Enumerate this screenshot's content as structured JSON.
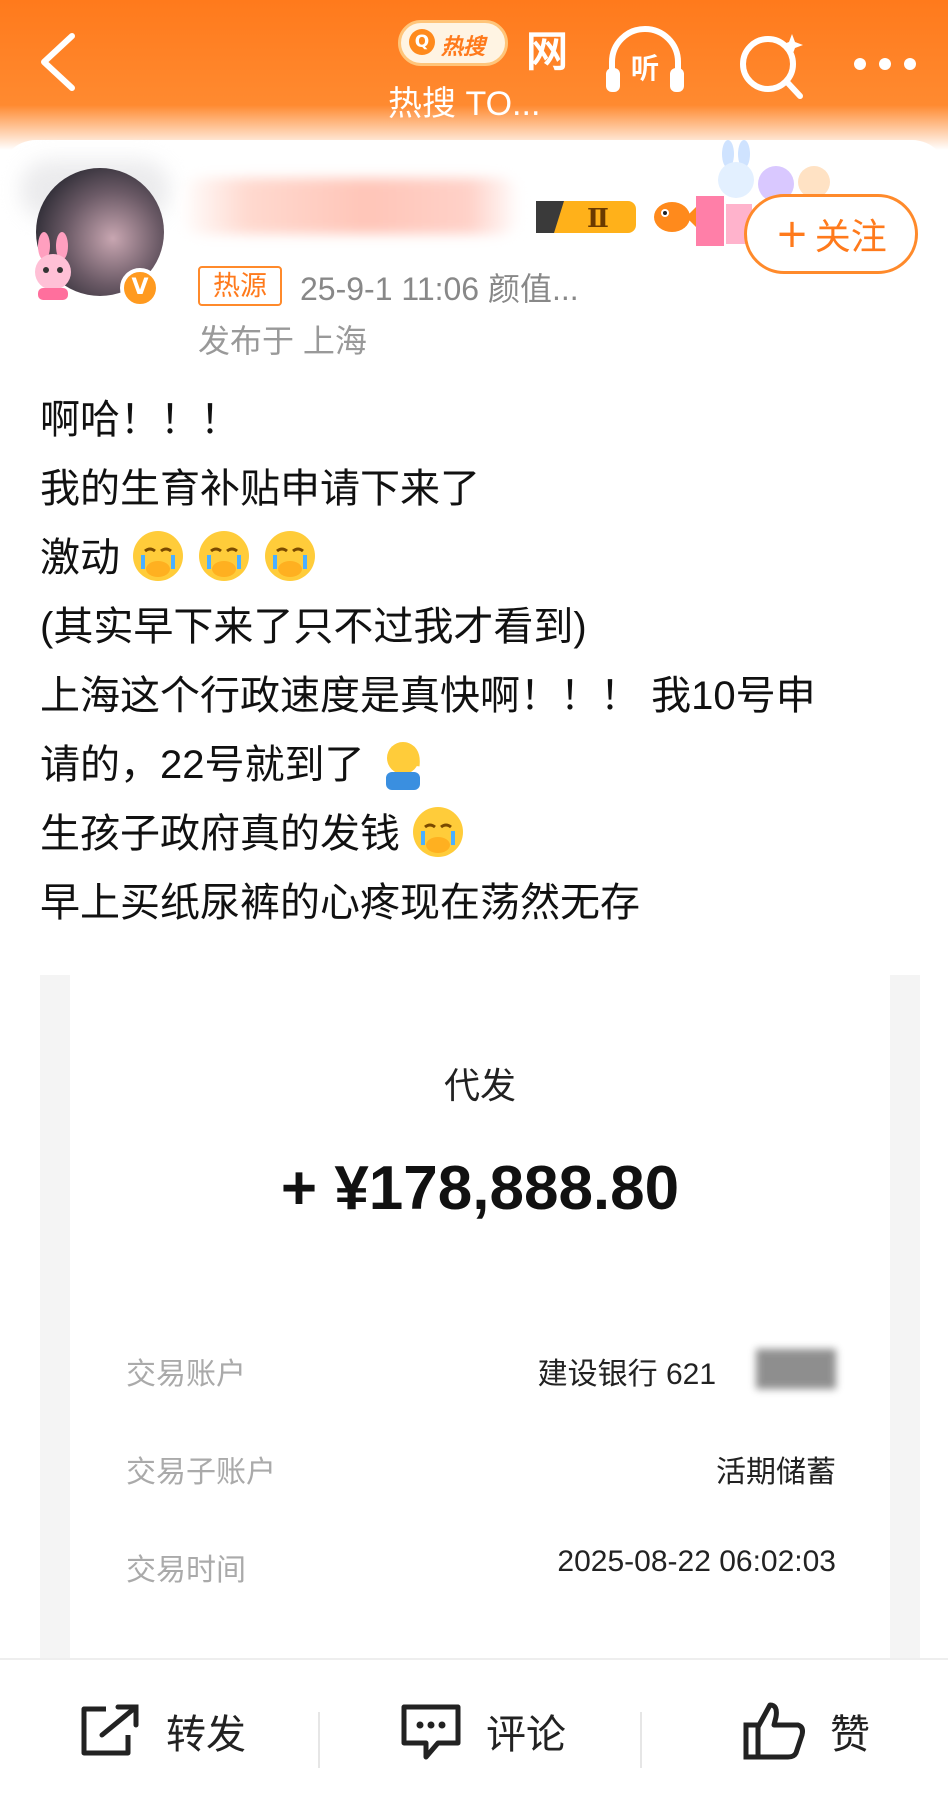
{
  "header": {
    "brand_search": "热搜",
    "brand_net": "网",
    "title": "热搜 TO...",
    "icons": [
      "back-icon",
      "listen-icon",
      "search-icon",
      "more-icon"
    ],
    "listen_label": "听"
  },
  "user": {
    "follow_label": "关注",
    "hot_tag": "热源",
    "time_meta": "25-9-1 11:06  颜值...",
    "location": "发布于 上海",
    "level": "Ⅱ"
  },
  "post": {
    "lines": [
      "啊哈！！！",
      "我的生育补贴申请下来了",
      "激动",
      "(其实早下来了只不过我才看到)",
      "上海这个行政速度是真快啊！！！ 我10号申",
      "请的，22号就到了",
      "生孩子政府真的发钱",
      "早上买纸尿裤的心疼现在荡然无存"
    ]
  },
  "screenshot": {
    "label": "代发",
    "amount": "+ ¥178,888.80",
    "rows": [
      {
        "key": "交易账户",
        "value": "建设银行 621"
      },
      {
        "key": "交易子账户",
        "value": "活期储蓄"
      },
      {
        "key": "交易时间",
        "value": "2025-08-22 06:02:03"
      }
    ]
  },
  "bottom": {
    "repost": "转发",
    "comment": "评论",
    "like": "赞"
  },
  "colors": {
    "brand_orange": "#ff7a1c",
    "follow_border": "#ff8a2b"
  }
}
